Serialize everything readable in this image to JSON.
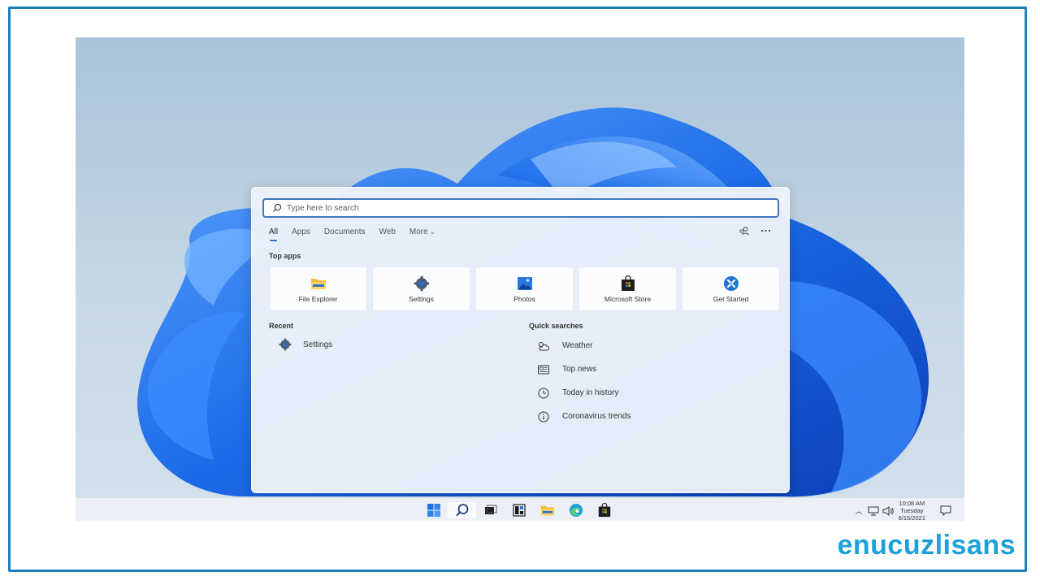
{
  "brand": {
    "text": "enucuzlisans"
  },
  "search": {
    "placeholder": "Type here to search"
  },
  "tabs": [
    {
      "label": "All",
      "active": true
    },
    {
      "label": "Apps"
    },
    {
      "label": "Documents"
    },
    {
      "label": "Web"
    },
    {
      "label": "More"
    }
  ],
  "top_apps": {
    "title": "Top apps",
    "items": [
      {
        "label": "File Explorer",
        "icon": "folder-icon"
      },
      {
        "label": "Settings",
        "icon": "gear-icon"
      },
      {
        "label": "Photos",
        "icon": "photos-icon"
      },
      {
        "label": "Microsoft Store",
        "icon": "store-icon"
      },
      {
        "label": "Get Started",
        "icon": "get-started-icon"
      }
    ]
  },
  "recent": {
    "title": "Recent",
    "items": [
      {
        "label": "Settings",
        "icon": "gear-icon"
      }
    ]
  },
  "quick_searches": {
    "title": "Quick searches",
    "items": [
      {
        "label": "Weather",
        "icon": "weather-icon"
      },
      {
        "label": "Top news",
        "icon": "news-icon"
      },
      {
        "label": "Today in history",
        "icon": "clock-icon"
      },
      {
        "label": "Coronavirus trends",
        "icon": "info-icon"
      }
    ]
  },
  "taskbar": {
    "clock": {
      "time": "10:08 AM",
      "day": "Tuesday",
      "date": "6/15/2021"
    }
  },
  "colors": {
    "accent": "#2a6fd1",
    "frame": "#1c7fb9",
    "brand": "#1ea0d9",
    "bloom": "#1f6fe6"
  }
}
